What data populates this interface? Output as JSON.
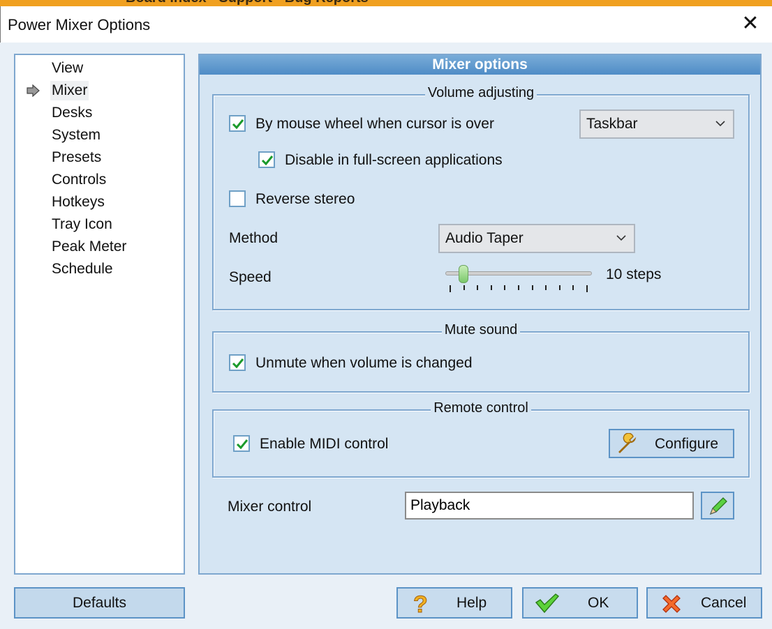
{
  "background_page": {
    "breadcrumb": "Board index · Support · Bug Reports"
  },
  "window": {
    "title": "Power Mixer Options",
    "close_icon": "close-icon"
  },
  "sidebar": {
    "items": [
      {
        "label": "View",
        "selected": false
      },
      {
        "label": "Mixer",
        "selected": true
      },
      {
        "label": "Desks",
        "selected": false
      },
      {
        "label": "System",
        "selected": false
      },
      {
        "label": "Presets",
        "selected": false
      },
      {
        "label": "Controls",
        "selected": false
      },
      {
        "label": "Hotkeys",
        "selected": false
      },
      {
        "label": "Tray Icon",
        "selected": false
      },
      {
        "label": "Peak Meter",
        "selected": false
      },
      {
        "label": "Schedule",
        "selected": false
      }
    ],
    "selected_icon": "arrow-right-icon"
  },
  "panel": {
    "title": "Mixer options",
    "volume": {
      "legend": "Volume adjusting",
      "mouse_wheel": {
        "label": "By mouse wheel when cursor is over",
        "checked": true
      },
      "wheel_target": {
        "value": "Taskbar"
      },
      "fullscreen": {
        "label": "Disable in full-screen applications",
        "checked": true
      },
      "reverse": {
        "label": "Reverse stereo",
        "checked": false
      },
      "method": {
        "label": "Method",
        "value": "Audio Taper"
      },
      "speed": {
        "label": "Speed",
        "value_text": "10 steps",
        "position": 1,
        "max": 10
      }
    },
    "mute": {
      "legend": "Mute sound",
      "unmute": {
        "label": "Unmute when volume is changed",
        "checked": true
      }
    },
    "remote": {
      "legend": "Remote control",
      "midi": {
        "label": "Enable MIDI control",
        "checked": true
      },
      "configure": "Configure"
    },
    "mixer_control": {
      "label": "Mixer control",
      "value": "Playback"
    }
  },
  "footer": {
    "defaults": "Defaults",
    "help": "Help",
    "ok": "OK",
    "cancel": "Cancel"
  },
  "colors": {
    "accent": "#4f8cc6",
    "border": "#7ea7cf",
    "panel_bg": "#d5e5f3",
    "check": "#1a9a2a"
  }
}
